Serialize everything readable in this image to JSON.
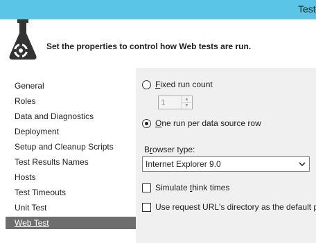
{
  "window": {
    "title": "Test"
  },
  "header": {
    "text": "Set the properties to control how Web tests are run.",
    "icon": "flask-gear-icon"
  },
  "sidebar": {
    "items": [
      {
        "label": "General"
      },
      {
        "label": "Roles"
      },
      {
        "label": "Data and Diagnostics"
      },
      {
        "label": "Deployment"
      },
      {
        "label": "Setup and Cleanup Scripts"
      },
      {
        "label": "Test Results Names"
      },
      {
        "label": "Hosts"
      },
      {
        "label": "Test Timeouts"
      },
      {
        "label": "Unit Test"
      },
      {
        "label": "Web Test"
      }
    ],
    "selected": "Web Test"
  },
  "main": {
    "fixed_run": {
      "label": "Fixed run count",
      "underline": "F",
      "rest": "ixed run count",
      "selected": false
    },
    "run_count": {
      "value": "1"
    },
    "per_row": {
      "label": "One run per data source row",
      "underline": "O",
      "rest": "ne run per data source row",
      "selected": true
    },
    "browser": {
      "label": "Browser type:",
      "pre": "B",
      "underline": "r",
      "rest": "owser type:",
      "value": "Internet Explorer 9.0"
    },
    "simulate": {
      "label": "Simulate think times",
      "pre": "Simulate ",
      "underline": "t",
      "rest": "hink times",
      "checked": false
    },
    "request_url": {
      "label": "Use request URL's directory as the default pa",
      "checked": false
    }
  },
  "colors": {
    "titlebar": "#5bc5e8",
    "selected_item": "#6e6e6e",
    "panel": "#f0f0f0"
  }
}
